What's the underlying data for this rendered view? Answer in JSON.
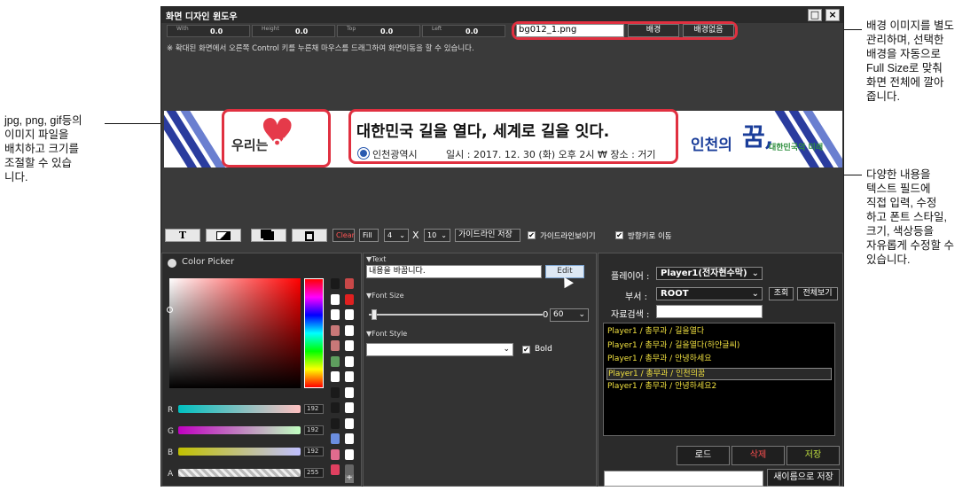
{
  "callouts": {
    "right_top": "배경 이미지를 별도\n관리하며, 선택한\n배경을 자동으로\nFull Size로 맞춰\n화면 전체에 깔아\n줍니다.",
    "left": "jpg, png, gif등의\n이미지 파일을\n배치하고 크기를\n조절할 수 있습\n니다.",
    "right_bottom": "다양한 내용을\n텍스트 필드에\n직접 입력, 수정\n하고 폰트 스타일,\n크기, 색상등을\n자유롭게 수정할 수\n있습니다."
  },
  "window": {
    "title": "화면 디자인 윈도우",
    "maximize": "□",
    "close": "×"
  },
  "dims": [
    {
      "label": "With",
      "value": "0.0"
    },
    {
      "label": "Height",
      "value": "0.0"
    },
    {
      "label": "Top",
      "value": "0.0"
    },
    {
      "label": "Left",
      "value": "0.0"
    }
  ],
  "background": {
    "file": "bg012_1.png",
    "bg_button": "배경",
    "nobg_button": "배경없음"
  },
  "notice": "※ 확대된 화면에서 오른쪽 Control 키를 누른채 마우스를 드래그하여 화면이동을 할 수 있습니다.",
  "banner": {
    "left_text_1": "우리는",
    "left_text_2": "인천",
    "headline": "대한민국 길을 열다, 세계로 길을 잇다.",
    "org": "인천광역시",
    "details": "일시 :  2017. 12. 30 (화) 오후 2시 ₩ 장소 : 거기",
    "right_text_1": "인천의",
    "right_text_2": "꿈,",
    "right_text_3": "대한민국의 미래"
  },
  "toolbar": {
    "text_icon": "T",
    "clear": "Clear",
    "fill": "Fill",
    "grid_x": "4",
    "x": "X",
    "grid_y": "10",
    "save_guide": "가이드라인 저장",
    "show_guide": "가이드라인보이기",
    "arrow_move": "방향키로 이동",
    "check": "✔"
  },
  "color_picker": {
    "title": "Color Picker",
    "r_label": "R",
    "g_label": "G",
    "b_label": "B",
    "a_label": "A",
    "r": "192",
    "g": "192",
    "b": "192",
    "a": "255",
    "plus": "+",
    "swatches_left": [
      "#1a1a1a",
      "#ffffff",
      "#ffffff",
      "#c87878",
      "#c87878",
      "#5e9e5e",
      "#ffffff",
      "#1a1a1a",
      "#1a1a1a",
      "#1a1a1a",
      "#6b8ee0",
      "#e06b8e",
      "#e04060"
    ],
    "swatches_right": [
      "#c84848",
      "#e02020",
      "#ffffff",
      "#ffffff",
      "#ffffff",
      "#ffffff",
      "#ffffff",
      "#ffffff",
      "#ffffff",
      "#ffffff",
      "#ffffff",
      "#ffffff",
      "#666666"
    ]
  },
  "text_panel": {
    "text_section": "▼Text",
    "text_value": "내용을 바꿉니다.",
    "edit_button": "Edit",
    "font_size_section": "▼Font Size",
    "font_size_min": "0",
    "font_size_value": "60",
    "font_style_section": "▼Font Style",
    "font_style_value": "",
    "bold_label": "Bold"
  },
  "player_panel": {
    "player_label": "플레이어 :",
    "player_value": "Player1(전자현수막)",
    "dept_label": "부서 :",
    "dept_value": "ROOT",
    "query_button": "조회",
    "view_all_button": "전체보기",
    "search_label": "자료검색 :",
    "search_value": "",
    "items": [
      "Player1 / 총무과 / 길을열다",
      "Player1 / 총무과 / 길을열다(하얀글씨)",
      "Player1 / 총무과 / 안녕하세요",
      "Player1 / 총무과 / 인천의꿈",
      "Player1 / 총무과 / 안녕하세요2"
    ],
    "selected_index": 3,
    "load_button": "로드",
    "delete_button": "삭제",
    "save_button": "저장",
    "new_name_value": "",
    "save_as_button": "새이름으로 저장"
  },
  "colors": {
    "accent_red": "#e03040",
    "banner_blue": "#2a3c9e",
    "list_text": "#f0e040",
    "delete_red": "#ff5050",
    "save_green": "#c0e040"
  }
}
